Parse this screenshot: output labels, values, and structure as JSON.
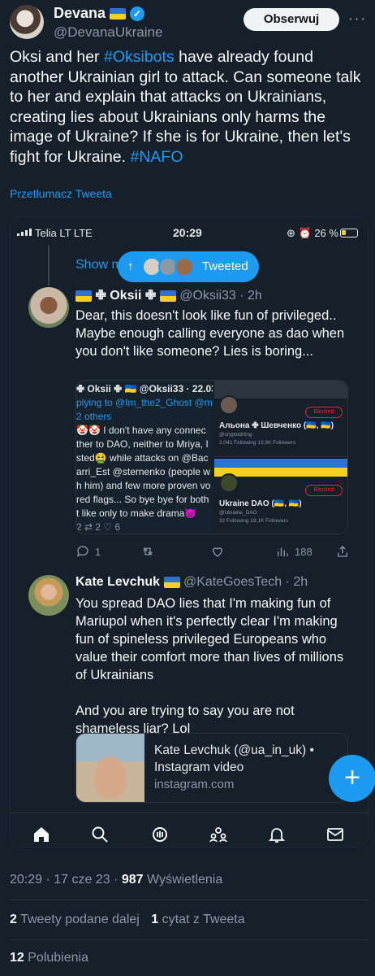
{
  "author": {
    "name": "Devana",
    "handle": "@DevanaUkraine",
    "follow_label": "Obserwuj"
  },
  "tweet": {
    "text_1": "Oksi and her ",
    "hashtag_1": "#Oksibots",
    "text_2": "  have already found another Ukrainian girl to attack. Can someone talk to her and explain that attacks on Ukrainians, creating lies about Ukrainians only harms the image of Ukraine? If she is for Ukraine, then let's fight for Ukraine. ",
    "hashtag_2": "#NAFO",
    "translate_label": "Przetłumacz Tweeta"
  },
  "screenshot": {
    "status_bar": {
      "carrier": "Telia LT  LTE",
      "time": "20:29",
      "battery": "26 %"
    },
    "show_more": "Show m",
    "tweeted_pill": "Tweeted",
    "reply_1": {
      "name": "✙ Oksii ✙",
      "handle": "@Oksii33",
      "age": "2h",
      "text": "Dear, this doesn't look like fun of privileged.. Maybe enough calling everyone as dao when you don't like someone?  Lies is boring...",
      "media_left_lines": [
        "✙ Oksii ✙ 🇺🇦 @Oksii33 · 22.03",
        "plying to @Im_the2_Ghost @m",
        "2 others",
        "🤡🤡 I don't have any connec",
        "ther to DAO, neither to Mriya, I",
        "sted🤮 while attacks on @Bac",
        "arri_Est @sternenko (people w",
        "h him) and few more proven vo",
        "red flags... So bye bye for both",
        "t like only to make drama😈",
        "2     ⇄ 2        ♡ 6"
      ],
      "card_1": {
        "name": "Альона ✙ Шевченко (🇺🇦, 🇺🇦)",
        "handle": "@cryptodrting",
        "stats": "2.041 Following  13,9K Followers",
        "blocked": "Blocked"
      },
      "card_2": {
        "name": "Ukraine DAO (🇺🇦, 🇺🇦)",
        "handle": "@Ukraine_DAO",
        "stats": "32 Following  19,1K Followers",
        "blocked": "Blocked"
      },
      "replies": "1",
      "views": "188"
    },
    "reply_2": {
      "name": "Kate Levchuk",
      "handle": "@KateGoesTech",
      "age": "2h",
      "text": "You spread DAO lies that I'm making fun of Mariupol when it's perfectly clear I'm making fun of spineless privileged Europeans who value their comfort more than lives of millions of Ukrainians\n\nAnd you are trying to say you are not shameless liar? Lol",
      "link_title": "Kate Levchuk (@ua_in_uk) • Instagram video",
      "link_site": "instagram.com"
    },
    "fab_label": "+"
  },
  "footer": {
    "timestamp": "20:29 · 17 cze 23 · ",
    "views_count": "987",
    "views_label": " Wyświetlenia",
    "retweets_count": "2",
    "retweets_label": " Tweety podane dalej",
    "quotes_count": "1",
    "quotes_label": " cytat z Tweeta",
    "likes_count": "12",
    "likes_label": " Polubienia"
  }
}
